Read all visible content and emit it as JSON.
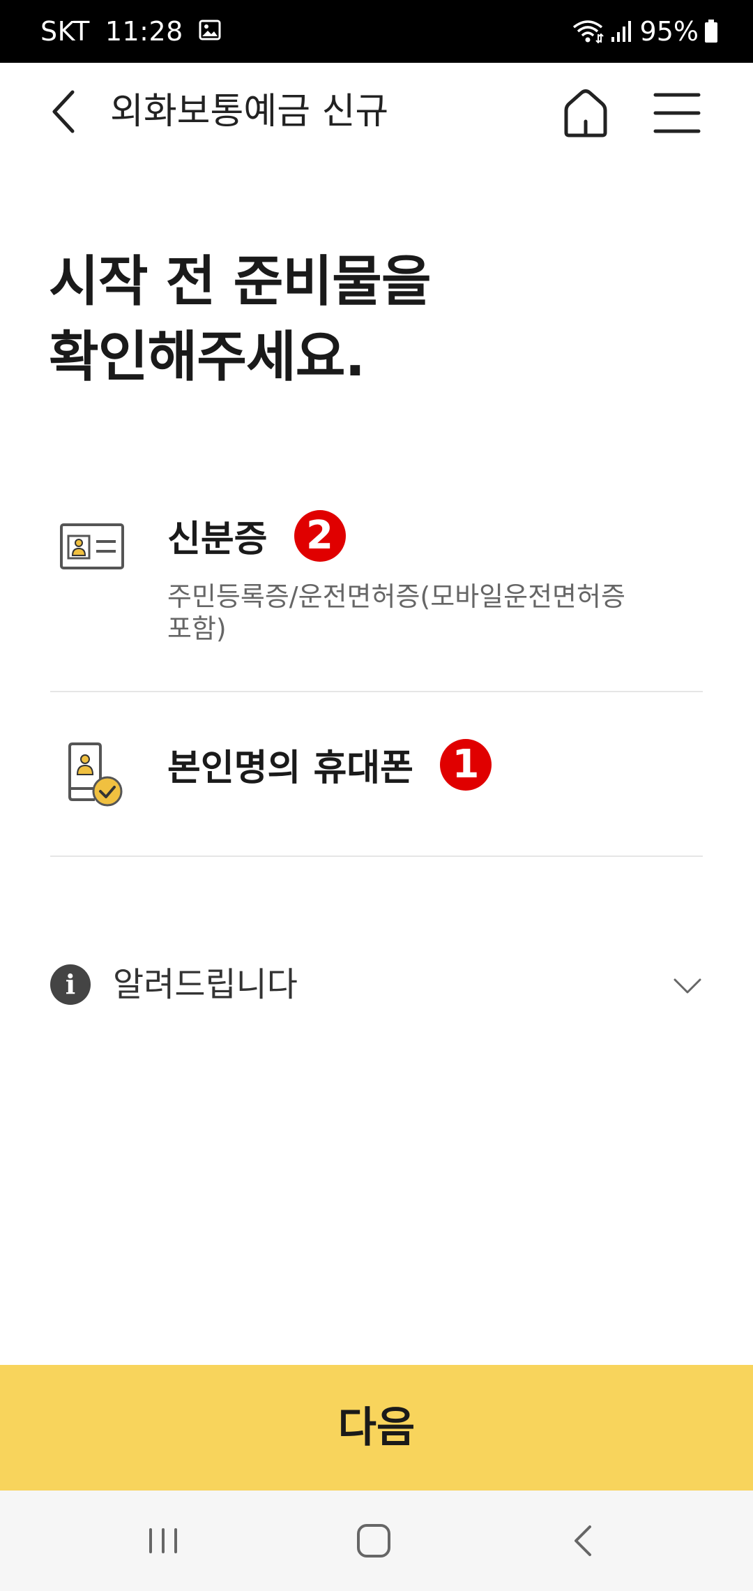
{
  "status_bar": {
    "carrier": "SKT",
    "time": "11:28",
    "battery": "95%"
  },
  "header": {
    "title": "외화보통예금 신규"
  },
  "page": {
    "title_line1": "시작 전 준비물을",
    "title_line2": "확인해주세요."
  },
  "items": [
    {
      "title": "신분증",
      "badge": "2",
      "description": "주민등록증/운전면허증(모바일운전면허증 포함)"
    },
    {
      "title": "본인명의 휴대폰",
      "badge": "1"
    }
  ],
  "notice": {
    "label": "알려드립니다"
  },
  "next_button": {
    "label": "다음"
  },
  "colors": {
    "accent_yellow": "#F8D45C",
    "badge_red": "#E00000",
    "icon_gold": "#F0C040",
    "text_dark": "#1A1A1A",
    "text_gray": "#666666"
  }
}
